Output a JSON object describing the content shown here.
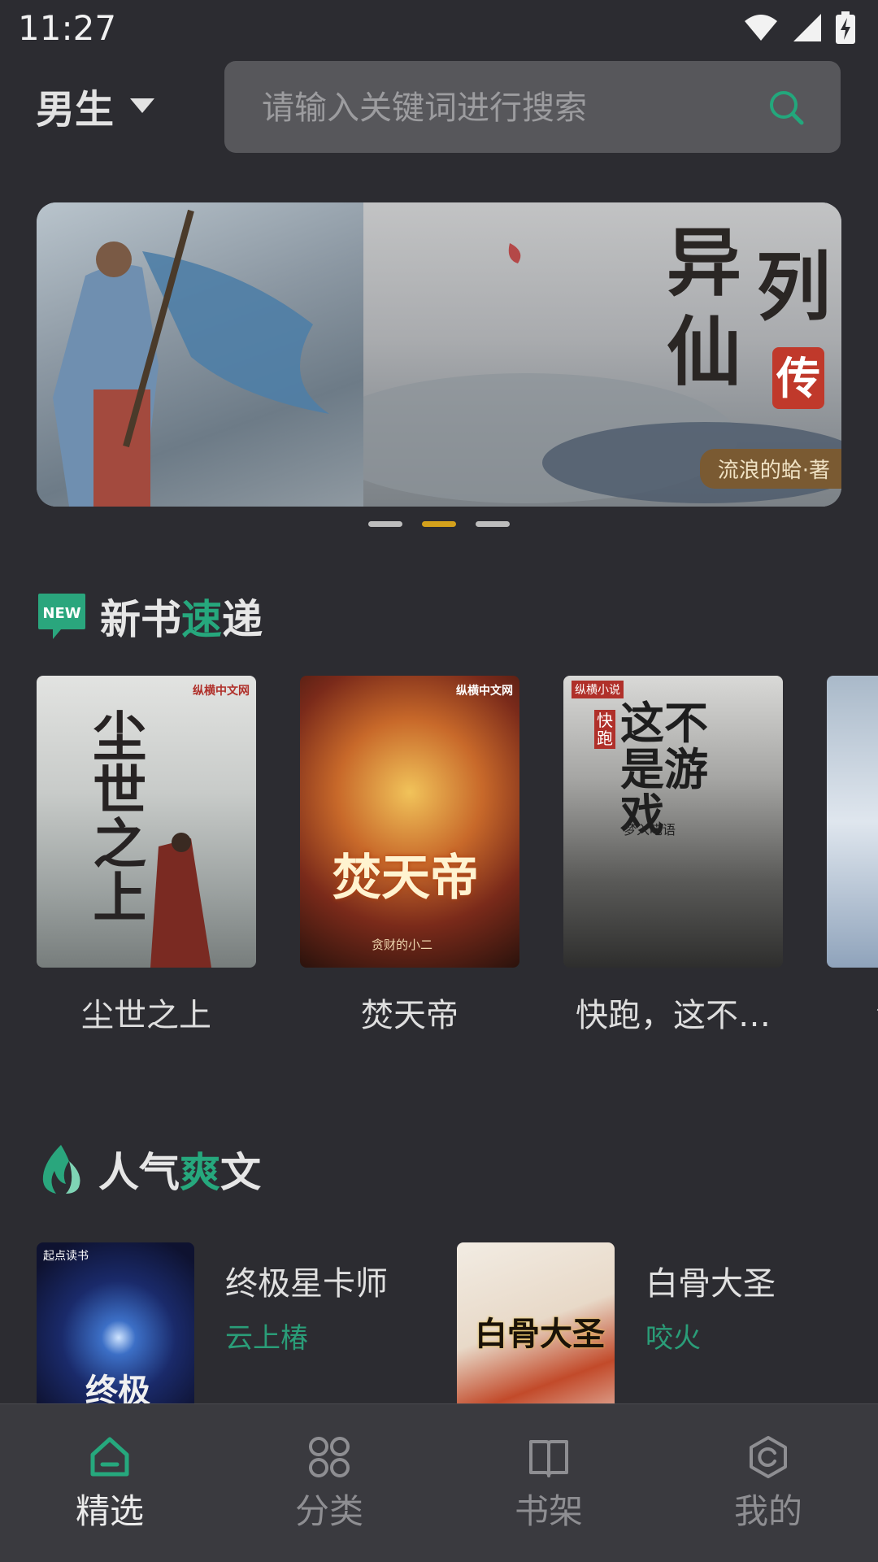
{
  "status_bar": {
    "time": "11:27"
  },
  "header": {
    "gender_label": "男生",
    "search_placeholder": "请输入关键词进行搜索"
  },
  "banner": {
    "title": "异仙列传",
    "seal": "传",
    "author_tag": "流浪的蛤·著",
    "dots": 3,
    "active_dot": 1
  },
  "new_books": {
    "title_a": "新书",
    "title_hl": "速",
    "title_b": "递",
    "badge": "NEW",
    "items": [
      {
        "name": "尘世之上",
        "cover_text": "尘世之上",
        "publisher": "纵横中文网"
      },
      {
        "name": "焚天帝",
        "cover_text": "焚天帝",
        "publisher": "纵横中文网",
        "cover_author": "贪财的小二"
      },
      {
        "name": "快跑，这不…",
        "cover_text": "这不是游戏",
        "publisher": "纵横小说",
        "cover_tag": "快跑",
        "cover_author": "梦入呓语"
      },
      {
        "name": "浊"
      }
    ]
  },
  "popular": {
    "title_a": "人气",
    "title_hl": "爽",
    "title_b": "文",
    "items": [
      {
        "name": "终极星卡师",
        "author": "云上椿",
        "publisher": "起点读书",
        "cover_text": "终极"
      },
      {
        "name": "白骨大圣",
        "author": "咬火",
        "cover_text": "白骨大圣"
      }
    ]
  },
  "nav": {
    "items": [
      {
        "label": "精选",
        "icon": "home-icon",
        "active": true
      },
      {
        "label": "分类",
        "icon": "category-icon",
        "active": false
      },
      {
        "label": "书架",
        "icon": "bookshelf-icon",
        "active": false
      },
      {
        "label": "我的",
        "icon": "profile-icon",
        "active": false
      }
    ]
  },
  "colors": {
    "accent": "#26a87d",
    "dot_active": "#d4a11c",
    "background": "#2c2c31"
  }
}
